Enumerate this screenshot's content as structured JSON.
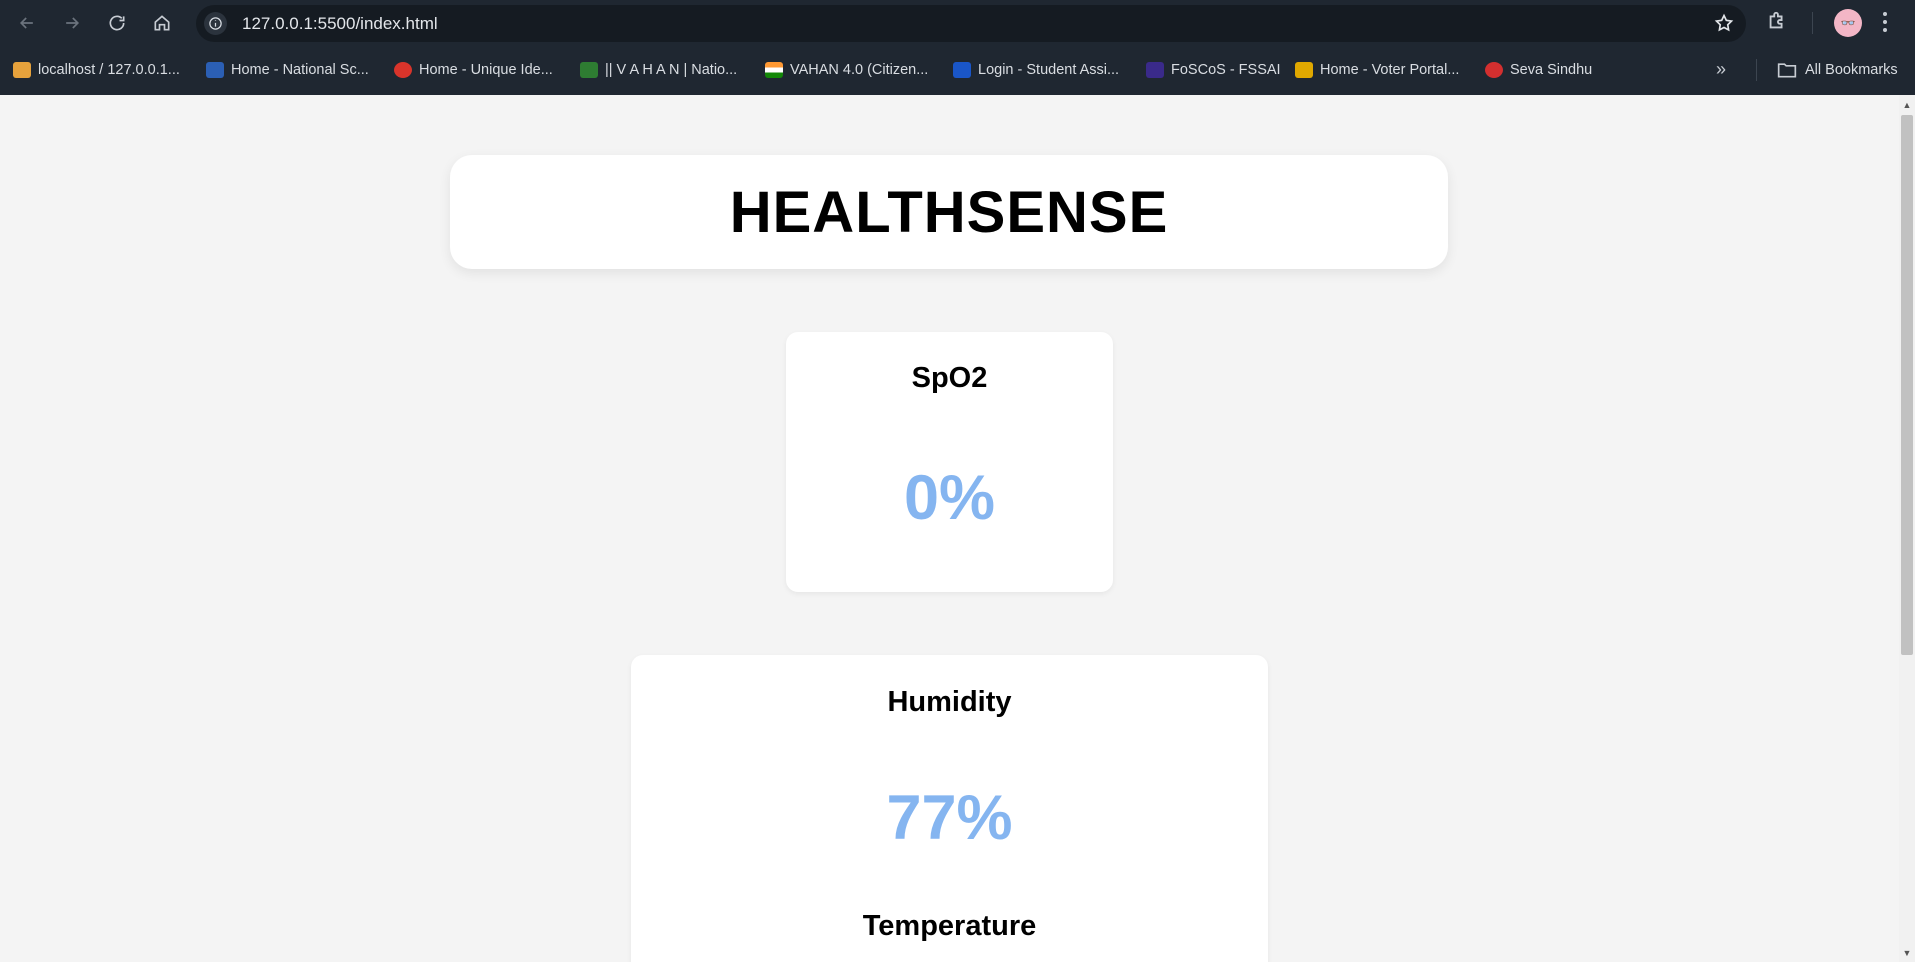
{
  "browser": {
    "url": "127.0.0.1:5500/index.html",
    "bookmarks": [
      {
        "label": "localhost / 127.0.0.1...",
        "icon": "phpmyadmin-icon",
        "color": "#e6a23c"
      },
      {
        "label": "Home - National Sc...",
        "icon": "nic-icon",
        "color": "#2b5fb4"
      },
      {
        "label": "Home - Unique Ide...",
        "icon": "aadhaar-icon",
        "color": "#d9342b"
      },
      {
        "label": "|| V A H A N | Natio...",
        "icon": "vahan-icon",
        "color": "#2e7d32"
      },
      {
        "label": "VAHAN 4.0 (Citizen...",
        "icon": "india-flag-icon",
        "color": "#ff9933"
      },
      {
        "label": "Login - Student Assi...",
        "icon": "n-icon",
        "color": "#1a56c8"
      },
      {
        "label": "FoSCoS - FSSAI",
        "icon": "fssai-icon",
        "color": "#3a2a8a"
      },
      {
        "label": "Home - Voter Portal...",
        "icon": "voter-icon",
        "color": "#e0a800"
      },
      {
        "label": "Seva Sindhu",
        "icon": "seva-sindhu-icon",
        "color": "#d32f2f"
      }
    ],
    "all_bookmarks": "All Bookmarks"
  },
  "app": {
    "title": "HEALTHSENSE",
    "spo2": {
      "label": "SpO2",
      "value": "0%"
    },
    "humidity": {
      "label": "Humidity",
      "value": "77%"
    },
    "temperature": {
      "label": "Temperature"
    }
  },
  "colors": {
    "value_accent": "#85b5f0",
    "chrome_bg": "#1f2731"
  }
}
